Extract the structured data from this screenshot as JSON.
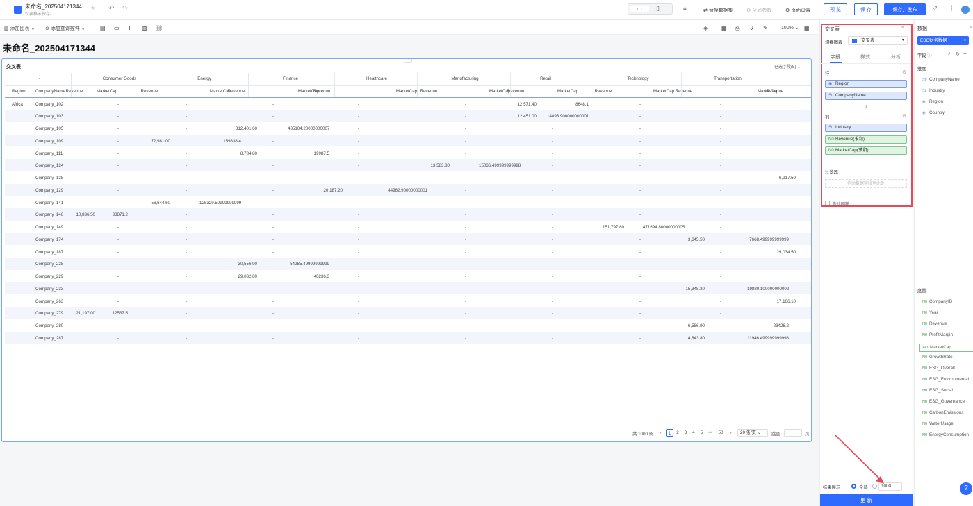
{
  "topbar": {
    "title": "未命名_202504171344",
    "subtitle": "仅表格未保存。",
    "replace_dataset": "替换数据集",
    "global_params": "全局参数",
    "page_settings": "页面设置",
    "preview": "预 览",
    "save": "保 存",
    "save_publish": "保存并发布"
  },
  "toolbar": {
    "add_chart": "添加图表",
    "add_query": "添加查询控件",
    "zoom": "100%"
  },
  "page_title": "未命名_202504171344",
  "card": {
    "title": "交叉表",
    "selected_fields": "已选字段(5)"
  },
  "table": {
    "industries": [
      "Consumer Goods",
      "Energy",
      "Finance",
      "Healthcare",
      "Manufacturing",
      "Retail",
      "Technology",
      "Transportation"
    ],
    "measure_headers": [
      "Revenue",
      "MarketCap"
    ],
    "dash_header": "-",
    "row_headers": [
      "Region",
      "CompanyName"
    ],
    "region": "Africa",
    "rows": [
      [
        "Company_102",
        "-",
        "",
        "-",
        "",
        "-",
        "",
        "-",
        "",
        "-",
        "",
        "12,571.40",
        "8648.1",
        "-",
        "",
        "-",
        "",
        "-"
      ],
      [
        "Company_103",
        "-",
        "",
        "-",
        "",
        "-",
        "",
        "-",
        "",
        "-",
        "",
        "12,451.00",
        "14893.900000000001",
        "-",
        "",
        "-",
        "",
        "-"
      ],
      [
        "Company_105",
        "-",
        "",
        "-",
        "",
        "312,401.60",
        "435104.20000000007",
        "-",
        "",
        "-",
        "",
        "-",
        "",
        "-",
        "",
        "-",
        "",
        "-"
      ],
      [
        "Company_109",
        "-",
        "",
        "72,981.00",
        "159838.4",
        "-",
        "",
        "-",
        "",
        "-",
        "",
        "-",
        "",
        "-",
        "",
        "-",
        "",
        "-"
      ],
      [
        "Company_111",
        "-",
        "",
        "-",
        "",
        "8,784.80",
        "19987.5",
        "-",
        "",
        "-",
        "",
        "-",
        "",
        "-",
        "",
        "-",
        "",
        "-"
      ],
      [
        "Company_124",
        "-",
        "",
        "-",
        "",
        "-",
        "",
        "-",
        "",
        "13,583.80",
        "15036.499999999998",
        "-",
        "",
        "-",
        "",
        "-",
        "",
        "-"
      ],
      [
        "Company_128",
        "-",
        "",
        "-",
        "",
        "-",
        "",
        "-",
        "",
        "-",
        "",
        "-",
        "",
        "-",
        "",
        "-",
        "",
        "6,917.50"
      ],
      [
        "Company_129",
        "-",
        "",
        "-",
        "",
        "-",
        "",
        "20,187.20",
        "44962.90000000001",
        "-",
        "",
        "-",
        "",
        "-",
        "",
        "-",
        "",
        "-"
      ],
      [
        "Company_141",
        "-",
        "",
        "56,644.60",
        "128329.59999999999",
        "-",
        "",
        "-",
        "",
        "-",
        "",
        "-",
        "",
        "-",
        "",
        "-",
        "",
        "-"
      ],
      [
        "Company_146",
        "10,836.50",
        "33871.2",
        "-",
        "",
        "-",
        "",
        "-",
        "",
        "-",
        "",
        "-",
        "",
        "-",
        "",
        "-",
        "",
        "-"
      ],
      [
        "Company_149",
        "-",
        "",
        "-",
        "",
        "-",
        "",
        "-",
        "",
        "-",
        "",
        "-",
        "",
        "151,797.80",
        "471694.80000000005",
        "-",
        "",
        "-"
      ],
      [
        "Company_174",
        "-",
        "",
        "-",
        "",
        "-",
        "",
        "-",
        "",
        "-",
        "",
        "-",
        "",
        "-",
        "",
        "3,645.50",
        "7668.499999999999",
        "-"
      ],
      [
        "Company_187",
        "-",
        "",
        "-",
        "",
        "-",
        "",
        "-",
        "",
        "-",
        "",
        "-",
        "",
        "-",
        "",
        "-",
        "",
        "29,034.50"
      ],
      [
        "Company_228",
        "-",
        "",
        "-",
        "",
        "30,556.90",
        "54285.49999999999",
        "-",
        "",
        "-",
        "",
        "-",
        "",
        "-",
        "",
        "-",
        "",
        "-"
      ],
      [
        "Company_229",
        "-",
        "",
        "-",
        "",
        "29,032.80",
        "46236.3",
        "-",
        "",
        "-",
        "",
        "-",
        "",
        "-",
        "",
        "-",
        "",
        "-"
      ],
      [
        "Company_233",
        "-",
        "",
        "-",
        "",
        "-",
        "",
        "-",
        "",
        "-",
        "",
        "-",
        "",
        "-",
        "",
        "15,348.30",
        "19880.100000000002",
        "-"
      ],
      [
        "Company_263",
        "-",
        "",
        "-",
        "",
        "-",
        "",
        "-",
        "",
        "-",
        "",
        "-",
        "",
        "-",
        "",
        "-",
        "",
        "17,166.10"
      ],
      [
        "Company_279",
        "21,197.00",
        "12537.5",
        "-",
        "",
        "-",
        "",
        "-",
        "",
        "-",
        "",
        "-",
        "",
        "-",
        "",
        "-",
        "",
        "-"
      ],
      [
        "Company_280",
        "-",
        "",
        "-",
        "",
        "-",
        "",
        "-",
        "",
        "-",
        "",
        "-",
        "",
        "-",
        "",
        "6,586.90",
        "23426.2",
        "-"
      ],
      [
        "Company_287",
        "-",
        "",
        "-",
        "",
        "-",
        "",
        "-",
        "",
        "-",
        "",
        "-",
        "",
        "-",
        "",
        "4,843.80",
        "11946.499999999998",
        "-"
      ]
    ]
  },
  "pager": {
    "total": "共 1000 条",
    "pages": [
      "1",
      "2",
      "3",
      "4",
      "5",
      "•••",
      "50"
    ],
    "page_size": "20 条/页",
    "goto": "跳至",
    "page_unit": "页"
  },
  "config": {
    "title": "交叉表",
    "switch_chart": "切换图表",
    "chart_type": "交叉表",
    "tabs": [
      "字段",
      "样式",
      "分析"
    ],
    "rows_label": "行",
    "columns_label": "列",
    "row_fields": [
      "Region",
      "CompanyName"
    ],
    "column_dim": "Industry",
    "column_measures": [
      "Revenue(求和)",
      "MarketCap(求和)"
    ],
    "filter_label": "过滤器",
    "filter_placeholder": "拖动数据字段至此处",
    "auto_refresh": "自动刷新",
    "result_label": "结果展示",
    "all_label": "全部",
    "limit": "1000",
    "update": "更 新"
  },
  "datapanel": {
    "title": "数据",
    "dataset": "ESG财务数据",
    "fields_label": "字段",
    "dimensions_label": "维度",
    "dimensions": [
      "CompanyName",
      "Industry",
      "Region",
      "Country"
    ],
    "measures_label": "度量",
    "measures": [
      "CompanyID",
      "Year",
      "Revenue",
      "ProfitMargin",
      "MarketCap",
      "GrowthRate",
      "ESG_Overall",
      "ESG_Environmental",
      "ESG_Social",
      "ESG_Governance",
      "CarbonEmissions",
      "WaterUsage",
      "EnergyConsumption"
    ]
  },
  "colors": {
    "accent": "#2f6bff",
    "highlight": "#e8485a"
  }
}
